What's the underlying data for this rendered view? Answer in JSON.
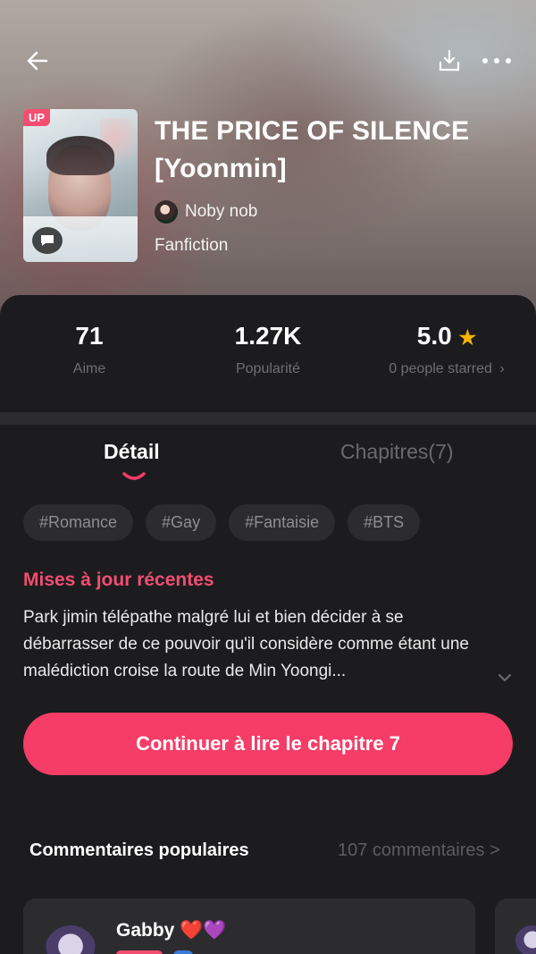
{
  "book": {
    "title": "THE PRICE OF SILENCE [Yoonmin]",
    "badge": "UP",
    "author": "Noby nob",
    "category": "Fanfiction"
  },
  "stats": {
    "likes": {
      "value": "71",
      "label": "Aime"
    },
    "popularity": {
      "value": "1.27K",
      "label": "Popularité"
    },
    "rating": {
      "value": "5.0",
      "label": "0 people starred"
    }
  },
  "tabs": {
    "detail": "Détail",
    "chapters": "Chapitres(7)"
  },
  "tags": [
    "#Romance",
    "#Gay",
    "#Fantaisie",
    "#BTS"
  ],
  "updates": {
    "heading": "Mises à jour récentes",
    "text": "Park jimin télépathe malgré lui et bien décider à se débarrasser de ce pouvoir qu'il considère comme étant une malédiction croise la route de Min Yoongi..."
  },
  "cta": {
    "label": "Continuer à lire le chapitre 7"
  },
  "comments": {
    "heading": "Commentaires populaires",
    "count": "107 commentaires >",
    "first": {
      "name": "Gabby ❤️💜"
    }
  },
  "colors": {
    "accent": "#f53d68",
    "star": "#f4b400",
    "panel": "#1c1c1e"
  },
  "icons": {
    "back": "arrow-left-icon",
    "download": "download-icon",
    "more": "more-horizontal-icon",
    "star": "star-icon",
    "chat": "chat-bubble-icon",
    "chevron": "chevron-down-icon"
  }
}
